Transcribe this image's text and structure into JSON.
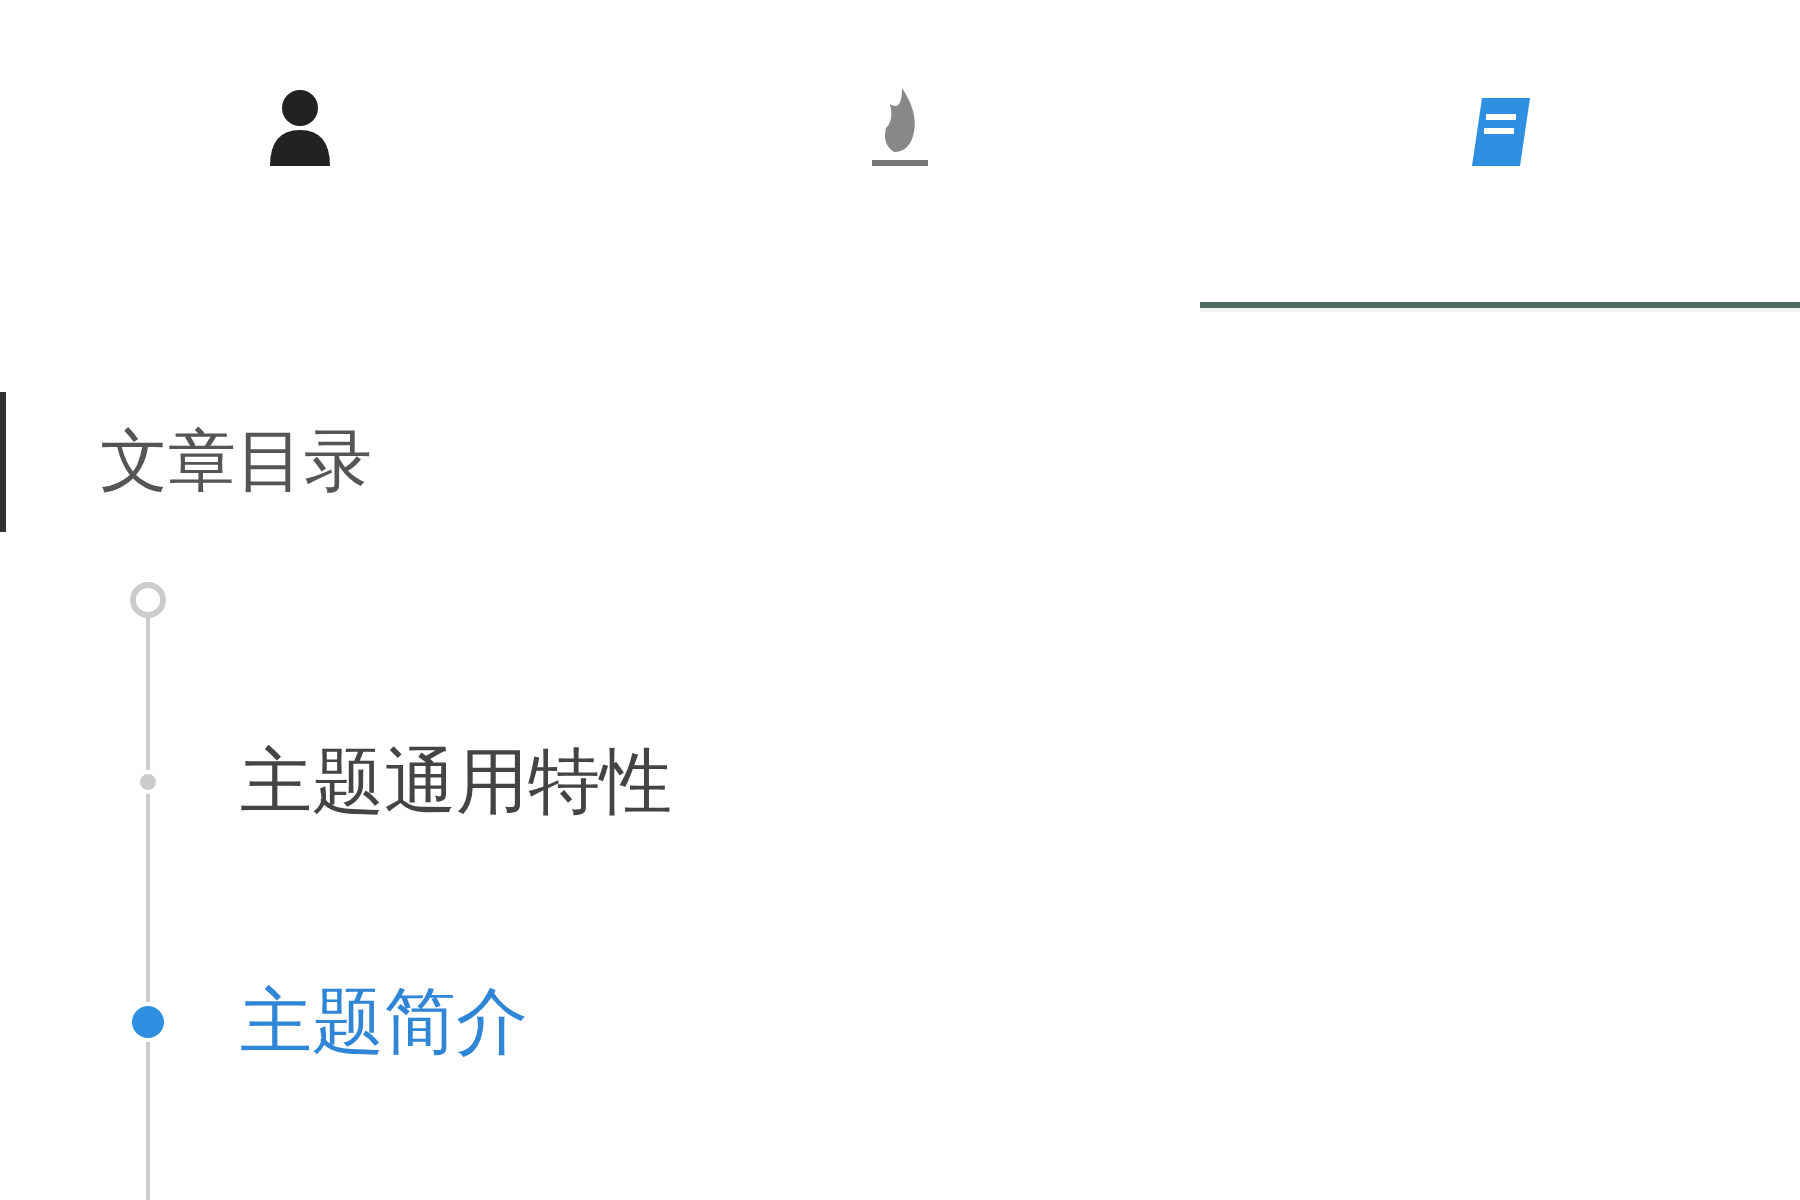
{
  "tabs": [
    {
      "kind": "person",
      "selected": false
    },
    {
      "kind": "flame",
      "selected": false
    },
    {
      "kind": "book",
      "selected": true
    }
  ],
  "toc": {
    "title": "文章目录",
    "items": [
      {
        "kind": "start",
        "selected": false
      },
      {
        "kind": "entry",
        "label": "主题通用特性",
        "selected": false
      },
      {
        "kind": "entry",
        "label": "主题简介",
        "selected": true
      }
    ]
  }
}
